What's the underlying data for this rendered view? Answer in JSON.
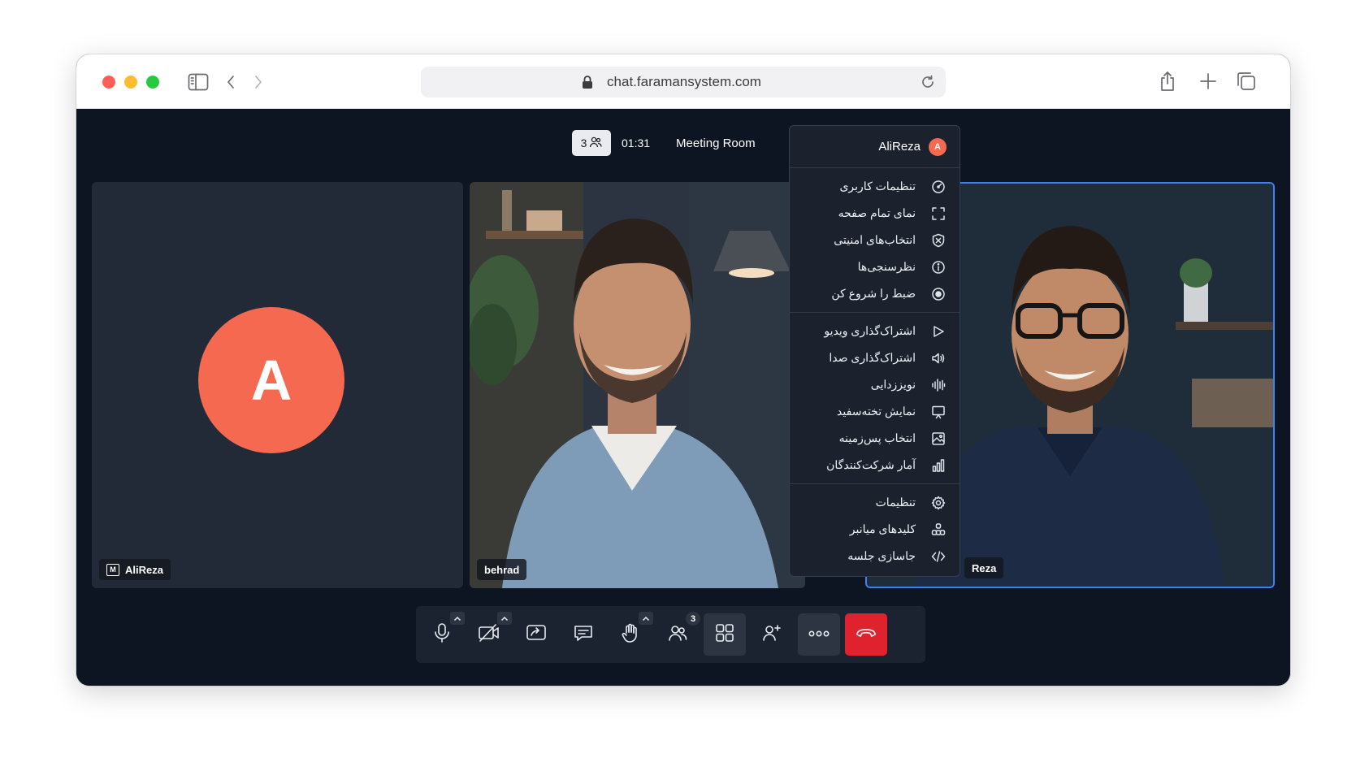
{
  "browser": {
    "url": "chat.faramansystem.com"
  },
  "meeting": {
    "participant_count": "3",
    "timer": "01:31",
    "room_name": "Meeting Room"
  },
  "tiles": [
    {
      "name": "AliReza",
      "avatar_letter": "A",
      "moderator_badge": "M",
      "avatar_color": "#f4694f"
    },
    {
      "name": "behrad"
    },
    {
      "name": "Reza",
      "highlight_color": "#3b82f6"
    }
  ],
  "menu": {
    "user_name": "AliReza",
    "user_avatar_letter": "A",
    "groups": [
      [
        {
          "label": "تنظیمات کاربری",
          "icon": "gauge-icon"
        },
        {
          "label": "نمای تمام صفحه",
          "icon": "fullscreen-icon"
        },
        {
          "label": "انتخاب‌های امنیتی",
          "icon": "shield-icon"
        },
        {
          "label": "نظرسنجی‌ها",
          "icon": "info-icon"
        },
        {
          "label": "ضبط را شروع کن",
          "icon": "record-icon"
        }
      ],
      [
        {
          "label": "اشتراک‌گذاری ویدیو",
          "icon": "play-icon"
        },
        {
          "label": "اشتراک‌گذاری صدا",
          "icon": "speaker-icon"
        },
        {
          "label": "نویززدایی",
          "icon": "waveform-icon"
        },
        {
          "label": "نمایش تخته‌سفید",
          "icon": "whiteboard-icon"
        },
        {
          "label": "انتخاب پس‌زمینه",
          "icon": "image-icon"
        },
        {
          "label": "آمار شرکت‌کنندگان",
          "icon": "stats-icon"
        }
      ],
      [
        {
          "label": "تنظیمات",
          "icon": "gear-icon"
        },
        {
          "label": "کلیدهای میانبر",
          "icon": "shortcuts-icon"
        },
        {
          "label": "جاسازی جلسه",
          "icon": "code-icon"
        }
      ]
    ]
  },
  "toolbar": {
    "participants_badge": "3",
    "end_call_color": "#e0212e"
  }
}
